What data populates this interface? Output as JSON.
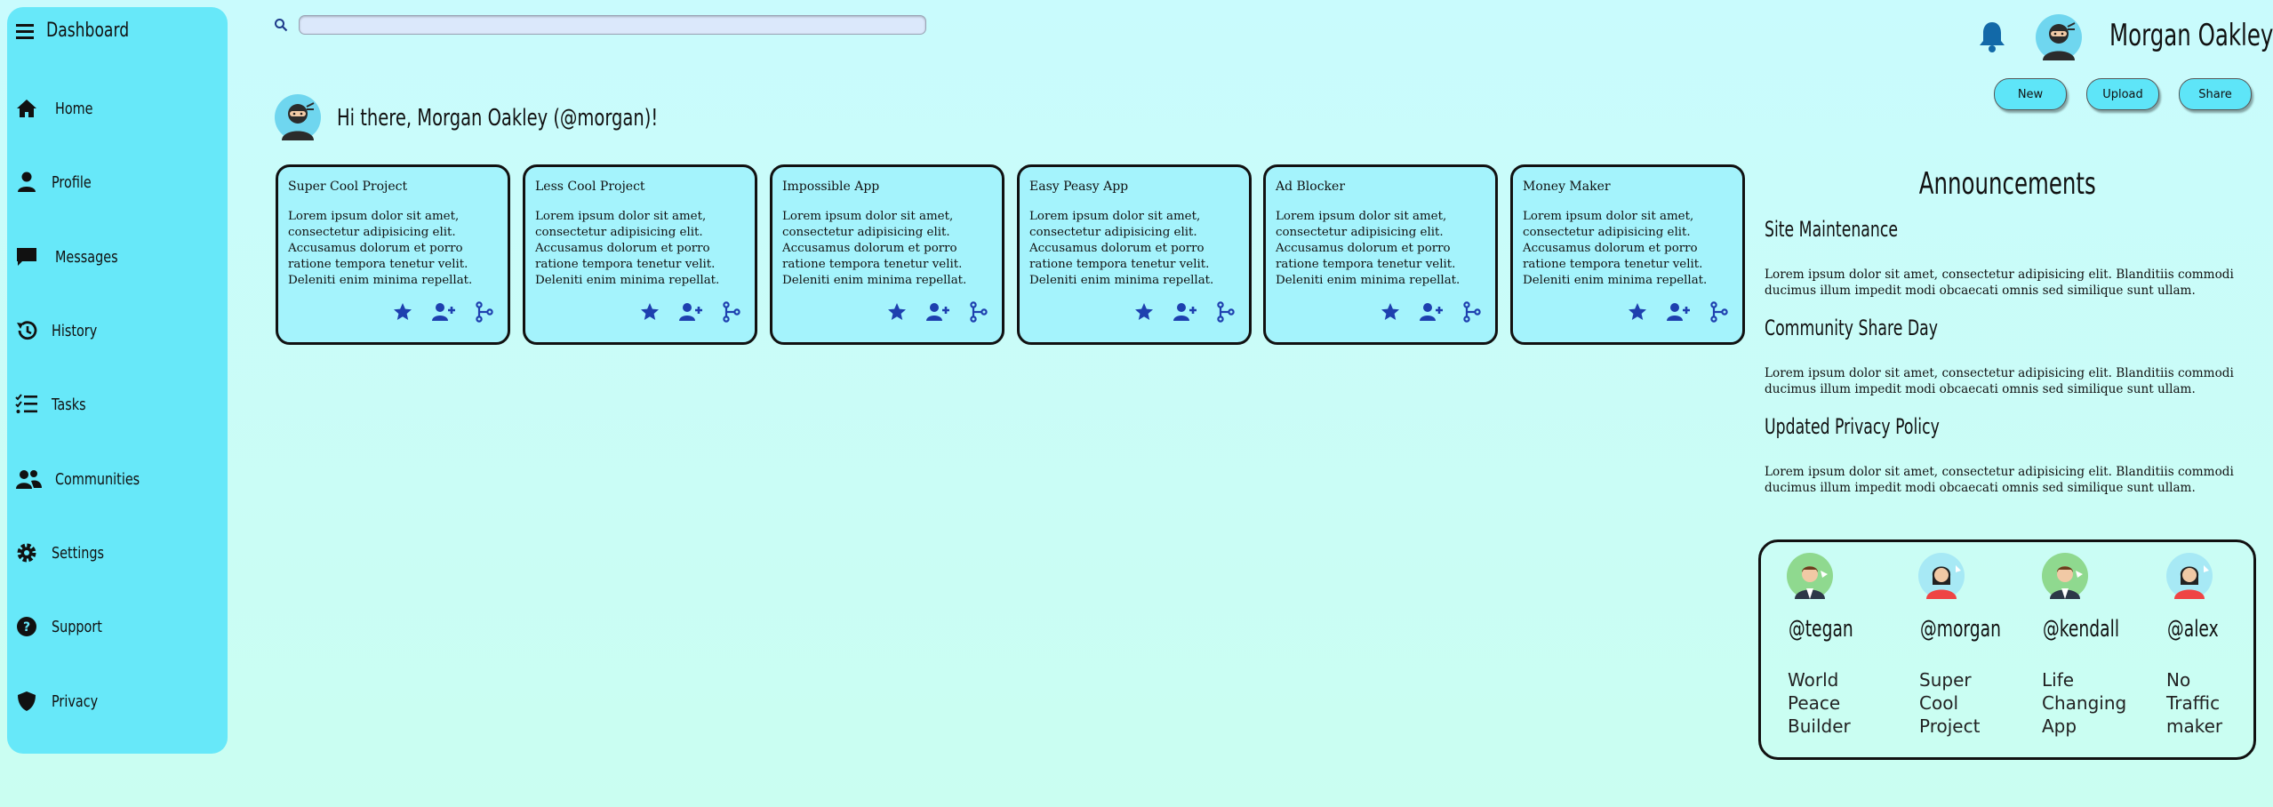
{
  "colors": {
    "sidebar": "#67e8f9",
    "card": "#a4f3fc",
    "icon_blue": "#1e40af",
    "button": "#5ee5f8"
  },
  "sidebar": {
    "brand": "Dashboard",
    "items": [
      {
        "label": "Home",
        "icon": "home-icon"
      },
      {
        "label": "Profile",
        "icon": "user-icon"
      },
      {
        "label": "Messages",
        "icon": "message-icon"
      },
      {
        "label": "History",
        "icon": "history-icon"
      },
      {
        "label": "Tasks",
        "icon": "tasks-icon"
      },
      {
        "label": "Communities",
        "icon": "users-icon"
      },
      {
        "label": "Settings",
        "icon": "gear-icon"
      },
      {
        "label": "Support",
        "icon": "help-icon"
      },
      {
        "label": "Privacy",
        "icon": "shield-icon"
      }
    ]
  },
  "header": {
    "search_placeholder": "",
    "username": "Morgan Oakley",
    "buttons": {
      "new": "New",
      "upload": "Upload",
      "share": "Share"
    }
  },
  "greeting": "Hi there, Morgan Oakley (@morgan)!",
  "projects": [
    {
      "title": "Super Cool Project",
      "desc": "Lorem ipsum dolor sit amet, consectetur adipisicing elit. Accusamus dolorum et porro ratione tempora tenetur velit. Deleniti enim minima repellat."
    },
    {
      "title": "Less Cool Project",
      "desc": "Lorem ipsum dolor sit amet, consectetur adipisicing elit. Accusamus dolorum et porro ratione tempora tenetur velit. Deleniti enim minima repellat."
    },
    {
      "title": "Impossible App",
      "desc": "Lorem ipsum dolor sit amet, consectetur adipisicing elit. Accusamus dolorum et porro ratione tempora tenetur velit. Deleniti enim minima repellat."
    },
    {
      "title": "Easy Peasy App",
      "desc": "Lorem ipsum dolor sit amet, consectetur adipisicing elit. Accusamus dolorum et porro ratione tempora tenetur velit. Deleniti enim minima repellat."
    },
    {
      "title": "Ad Blocker",
      "desc": "Lorem ipsum dolor sit amet, consectetur adipisicing elit. Accusamus dolorum et porro ratione tempora tenetur velit. Deleniti enim minima repellat."
    },
    {
      "title": "Money Maker",
      "desc": "Lorem ipsum dolor sit amet, consectetur adipisicing elit. Accusamus dolorum et porro ratione tempora tenetur velit. Deleniti enim minima repellat."
    }
  ],
  "announcements": {
    "title": "Announcements",
    "items": [
      {
        "heading": "Site Maintenance",
        "body": "Lorem ipsum dolor sit amet, consectetur adipisicing elit. Blanditiis commodi ducimus illum impedit modi obcaecati omnis sed similique sunt ullam."
      },
      {
        "heading": "Community Share Day",
        "body": "Lorem ipsum dolor sit amet, consectetur adipisicing elit. Blanditiis commodi ducimus illum impedit modi obcaecati omnis sed similique sunt ullam."
      },
      {
        "heading": "Updated Privacy Policy",
        "body": "Lorem ipsum dolor sit amet, consectetur adipisicing elit. Blanditiis commodi ducimus illum impedit modi obcaecati omnis sed similique sunt ullam."
      }
    ]
  },
  "trending": [
    {
      "handle": "@tegan",
      "project_lines": [
        "World",
        "Peace",
        "Builder"
      ]
    },
    {
      "handle": "@morgan",
      "project_lines": [
        "Super",
        "Cool",
        "Project"
      ]
    },
    {
      "handle": "@kendall",
      "project_lines": [
        "Life",
        "Changing",
        "App"
      ]
    },
    {
      "handle": "@alex",
      "project_lines": [
        "No",
        "Traffic",
        "maker"
      ]
    }
  ]
}
